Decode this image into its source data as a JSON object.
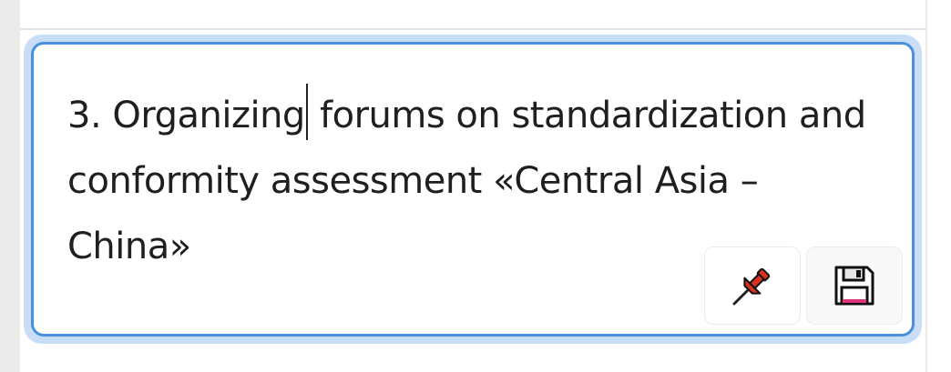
{
  "cell": {
    "text_before_caret": "3. Organizing",
    "text_after_caret": " forums on standardization and conformity assessment «Central Asia – China»"
  },
  "actions": [
    {
      "name": "pin",
      "icon": "pushpin-icon"
    },
    {
      "name": "save",
      "icon": "floppy-disk-icon"
    }
  ],
  "colors": {
    "editor_border": "#4a90d9",
    "focus_ring": "#c9ddf6",
    "pin": "#d9311f",
    "floppy_label": "#e0337a"
  }
}
